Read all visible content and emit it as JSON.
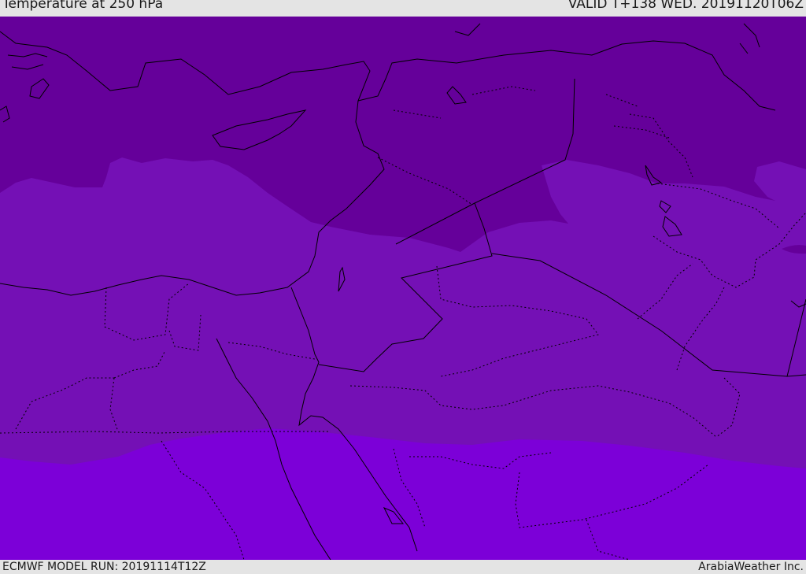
{
  "header": {
    "title": "Temperature at 250 hPa",
    "valid": "VALID T+138 WED. 20191120T06Z"
  },
  "footer": {
    "model_run": "ECMWF MODEL RUN: 20191114T12Z",
    "credit": "ArabiaWeather Inc."
  },
  "map": {
    "field": "Temperature at 250 hPa",
    "colors": {
      "band_cold": "#65009a",
      "band_mid": "#7410b5",
      "band_warm": "#7c00d8",
      "boundary": "#000000"
    }
  }
}
